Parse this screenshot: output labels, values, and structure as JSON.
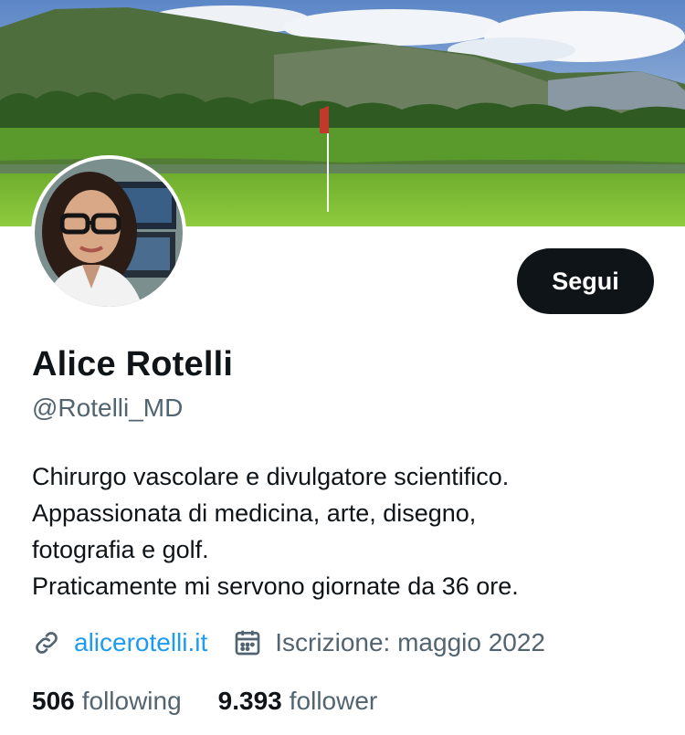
{
  "profile": {
    "name": "Alice Rotelli",
    "handle": "@Rotelli_MD",
    "follow_label": "Segui",
    "bio": [
      "Chirurgo vascolare e divulgatore scientifico.",
      "Appassionata di medicina, arte, disegno,",
      "fotografia e golf.",
      "Praticamente mi servono giornate da 36 ore."
    ],
    "website": "alicerotelli.it",
    "joined": "Iscrizione: maggio 2022",
    "stats": {
      "following_count": "506",
      "following_label": "following",
      "followers_count": "9.393",
      "followers_label": "follower"
    }
  },
  "icons": {
    "link": "link-icon",
    "calendar": "calendar-icon"
  },
  "colors": {
    "button_bg": "#0f1419",
    "link": "#1d9bf0",
    "secondary_text": "#536471"
  }
}
